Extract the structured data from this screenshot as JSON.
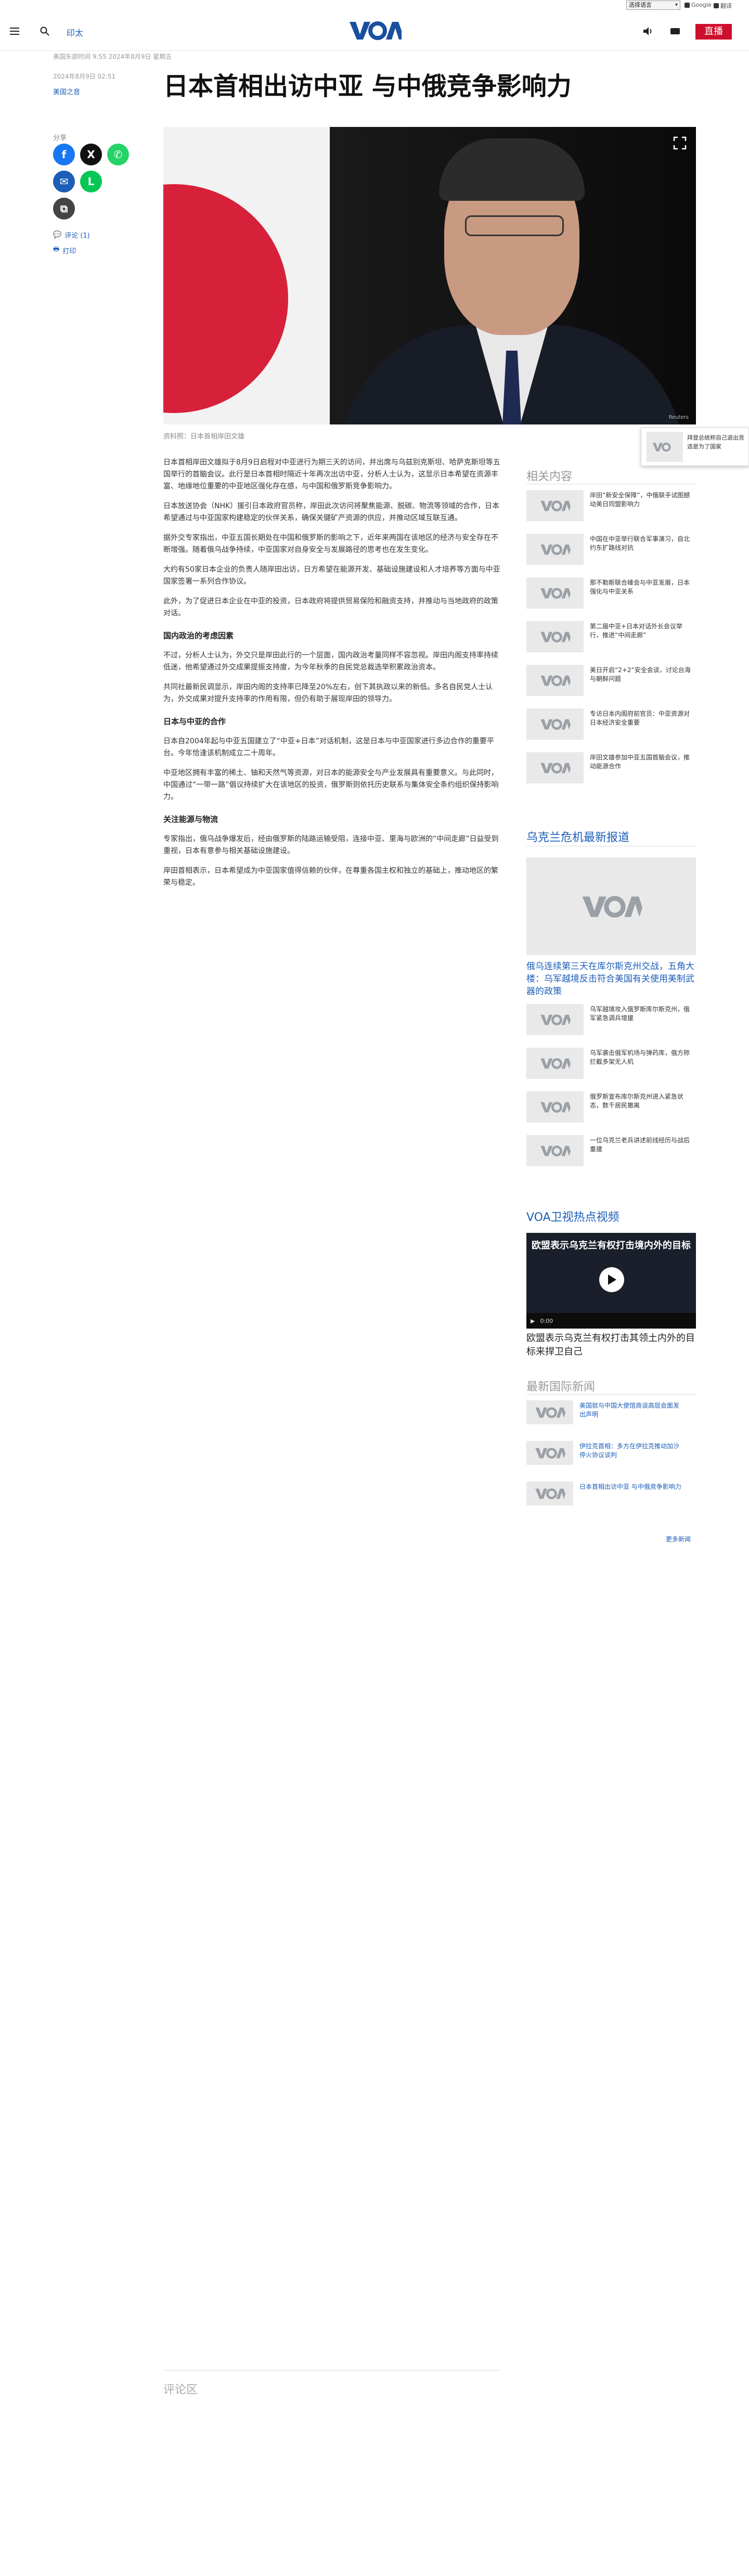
{
  "topbar": {
    "language": "选择语言",
    "links": [
      "Google",
      "翻译"
    ]
  },
  "header": {
    "section": "印太",
    "logo": "VOA",
    "live": "直播"
  },
  "article": {
    "breadcrumb": "美国东部时间 9:55 2024年8月9日 星期五",
    "date": "2024年8月9日 02:51",
    "author": "美国之音",
    "title": "日本首相出访中亚 与中俄竞争影响力",
    "share_label": "分享",
    "comments_link": "评论 (1)",
    "print_link": "打印",
    "caption": "资料照：日本首相岸田文雄",
    "photo_credit": "Reuters",
    "comments_title": "评论区",
    "body": [
      {
        "type": "p",
        "text": "日本首相岸田文雄拟于8月9日启程对中亚进行为期三天的访问，并出席与乌兹别克斯坦、哈萨克斯坦等五国举行的首脑会议。此行是日本首相时隔近十年再次出访中亚，分析人士认为，这显示日本希望在资源丰富、地缘地位重要的中亚地区强化存在感，与中国和俄罗斯竞争影响力。"
      },
      {
        "type": "p",
        "text": "日本放送协会（NHK）援引日本政府官员称，岸田此次访问将聚焦能源、脱碳、物流等领域的合作，日本希望通过与中亚国家构建稳定的伙伴关系，确保关键矿产资源的供应，并推动区域互联互通。"
      },
      {
        "type": "p",
        "text": "据外交专家指出，中亚五国长期处在中国和俄罗斯的影响之下，近年来两国在该地区的经济与安全存在不断增强。随着俄乌战争持续，中亚国家对自身安全与发展路径的思考也在发生变化。"
      },
      {
        "type": "p",
        "text": "大约有50家日本企业的负责人随岸田出访，日方希望在能源开发、基础设施建设和人才培养等方面与中亚国家签署一系列合作协议。"
      },
      {
        "type": "p",
        "text": "此外，为了促进日本企业在中亚的投资，日本政府将提供贸易保险和融资支持，并推动与当地政府的政策对话。"
      },
      {
        "type": "h",
        "text": "国内政治的考虑因素"
      },
      {
        "type": "p",
        "text": "不过，分析人士认为，外交只是岸田此行的一个层面，国内政治考量同样不容忽视。岸田内阁支持率持续低迷，他希望通过外交成果提振支持度，为今年秋季的自民党总裁选举积累政治资本。"
      },
      {
        "type": "p",
        "text": "共同社最新民调显示，岸田内阁的支持率已降至20%左右，创下其执政以来的新低。多名自民党人士认为，外交成果对提升支持率的作用有限，但仍有助于展现岸田的领导力。"
      },
      {
        "type": "h",
        "text": "日本与中亚的合作"
      },
      {
        "type": "p",
        "text": "日本自2004年起与中亚五国建立了“中亚+日本”对话机制，这是日本与中亚国家进行多边合作的重要平台。今年恰逢该机制成立二十周年。"
      },
      {
        "type": "p",
        "text": "中亚地区拥有丰富的稀土、铀和天然气等资源，对日本的能源安全与产业发展具有重要意义。与此同时，中国通过“一带一路”倡议持续扩大在该地区的投资，俄罗斯则依托历史联系与集体安全条约组织保持影响力。"
      },
      {
        "type": "h",
        "text": "关注能源与物流"
      },
      {
        "type": "p",
        "text": "专家指出，俄乌战争爆发后，经由俄罗斯的陆路运输受阻，连接中亚、里海与欧洲的“中间走廊”日益受到重视，日本有意参与相关基础设施建设。"
      },
      {
        "type": "p",
        "text": "岸田首相表示，日本希望成为中亚国家值得信赖的伙伴，在尊重各国主权和独立的基础上，推动地区的繁荣与稳定。"
      }
    ]
  },
  "sidebar": {
    "related_title": "相关内容",
    "related": [
      "岸田“新安全保障”，中俄联手试图撼动美日同盟影响力",
      "中国在中亚举行联合军事演习，自北约东扩路线对抗",
      "那不勒斯联合峰会与中亚发展，日本强化与中亚关系",
      "第二届中亚+日本对话外长会议举行，推进“中间走廊”",
      "美日开启“2+2”安全会谈，讨论台海与朝鲜问题",
      "专访日本内阁府前官员：中亚资源对日本经济安全重要",
      "岸田文雄参加中亚五国首脑会议，推动能源合作"
    ],
    "ukraine_title": "乌克兰危机最新报道",
    "ukraine_lead": "俄乌连续第三天在库尔斯克州交战，五角大楼：乌军越境反击符合美国有关使用美制武器的政策",
    "ukraine_items": [
      "乌军越境攻入俄罗斯库尔斯克州，俄军紧急调兵增援",
      "乌军袭击俄军机场与弹药库，俄方称拦截多架无人机",
      "俄罗斯宣布库尔斯克州进入紧急状态，数千居民撤离",
      "一位乌克兰老兵讲述前线经历与战后重建"
    ],
    "video_title": "VOA卫视热点视频",
    "video_head": "欧盟表示乌克兰有权打击境内外的目标",
    "video_caption": "欧盟表示乌克兰有权打击其领土内外的目标来捍卫自己",
    "video_time": "0:00",
    "news_title": "最新国际新闻",
    "news": [
      "美国就与中国大使馆商谈高层会面发出声明",
      "伊拉克首相：多方在伊拉克推动加沙停火协议谈判",
      "日本首相出访中亚 与中俄竞争影响力"
    ],
    "more": "更多新闻",
    "overlay": "拜登总统称自己退出竞选是为了国家"
  }
}
